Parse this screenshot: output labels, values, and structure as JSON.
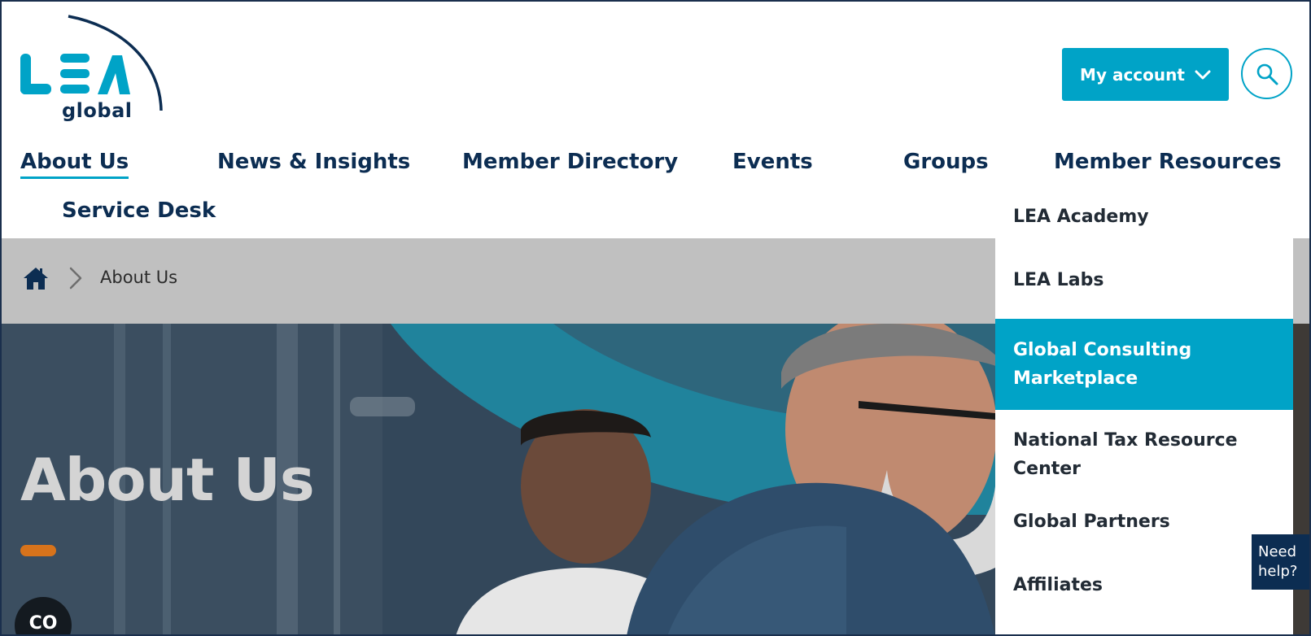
{
  "brand": {
    "logo_letters": "LEA",
    "logo_sub": "global",
    "color_primary": "#00a3c7",
    "color_navy": "#0c2d52",
    "color_accent": "#d7731b"
  },
  "header": {
    "account_label": "My account",
    "account_icon": "chevron-down-icon",
    "search_icon": "search-icon"
  },
  "nav": {
    "items": [
      {
        "label": "About Us",
        "active": true
      },
      {
        "label": "News & Insights"
      },
      {
        "label": "Member Directory"
      },
      {
        "label": "Events"
      },
      {
        "label": "Groups"
      },
      {
        "label": "Member Resources"
      },
      {
        "label": "Service Desk"
      }
    ]
  },
  "breadcrumb": {
    "home_icon": "home-icon",
    "separator_icon": "chevron-right-icon",
    "current": "About Us"
  },
  "hero": {
    "title": "About Us"
  },
  "dropdown": {
    "items": [
      {
        "label": "LEA Academy"
      },
      {
        "label": "LEA Labs"
      },
      {
        "label": "Global Consulting Marketplace",
        "highlighted": true
      },
      {
        "label": "National Tax Resource Center"
      },
      {
        "label": "Global Partners"
      },
      {
        "label": "Affiliates"
      }
    ]
  },
  "widgets": {
    "help_label": "Need help?",
    "caption_label": "CO",
    "caption_icon": "closed-caption-icon"
  }
}
